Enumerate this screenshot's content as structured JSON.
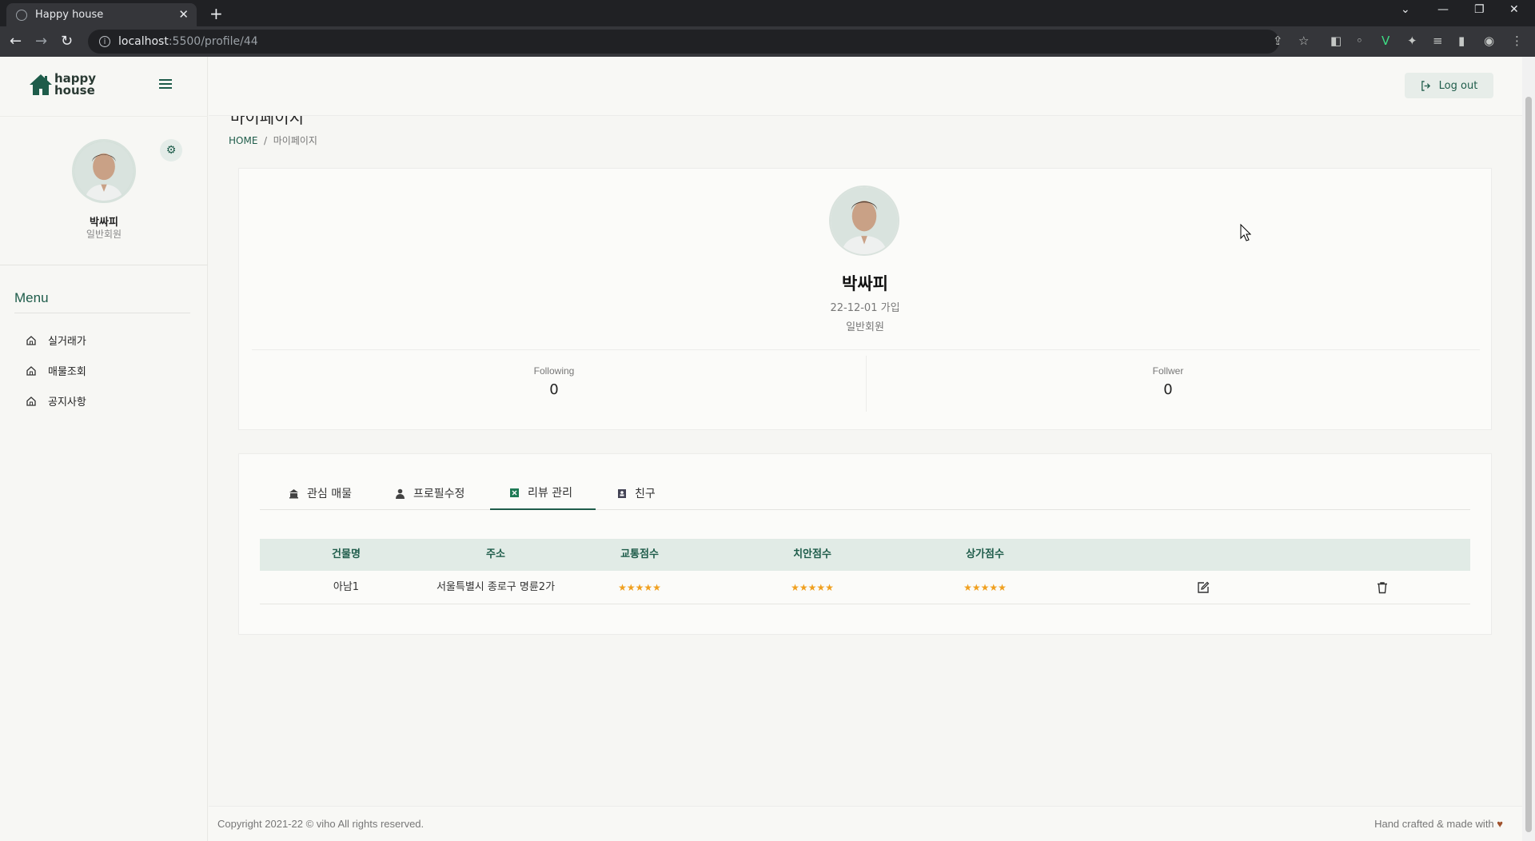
{
  "browser": {
    "tab_title": "Happy house",
    "url_host": "localhost",
    "url_path": ":5500/profile/44"
  },
  "app": {
    "logo_line1": "happy",
    "logo_line2": "house",
    "logout_label": "Log out"
  },
  "sidebar": {
    "user_name": "박싸피",
    "user_role": "일반회원",
    "menu_title": "Menu",
    "items": [
      {
        "label": "실거래가",
        "icon": "home-icon"
      },
      {
        "label": "매물조회",
        "icon": "home-icon"
      },
      {
        "label": "공지사항",
        "icon": "home-icon"
      }
    ]
  },
  "page": {
    "title": "마이페이지",
    "breadcrumb_home": "HOME",
    "breadcrumb_sep": "/",
    "breadcrumb_current": "마이페이지"
  },
  "profile": {
    "name": "박싸피",
    "joined": "22-12-01 가입",
    "role": "일반회원",
    "following_label": "Following",
    "following_count": "0",
    "follower_label": "Follwer",
    "follower_count": "0"
  },
  "tabs": [
    {
      "label": "관심 매물",
      "icon": "bank-icon"
    },
    {
      "label": "프로필수정",
      "icon": "user-icon"
    },
    {
      "label": "리뷰 관리",
      "icon": "spreadsheet-icon",
      "active": true
    },
    {
      "label": "친구",
      "icon": "contacts-icon"
    }
  ],
  "reviews": {
    "columns": [
      "건물명",
      "주소",
      "교통점수",
      "치안점수",
      "상가점수"
    ],
    "rows": [
      {
        "building": "아남1",
        "address": "서울특별시 종로구 명륜2가",
        "traffic": "★★★★★",
        "safety": "★★★★★",
        "commerce": "★★★★★",
        "traffic_score": 5,
        "safety_score": 5,
        "commerce_score": 5
      }
    ]
  },
  "footer": {
    "copyright": "Copyright 2021-22 © viho All rights reserved.",
    "crafted": "Hand crafted & made with",
    "heart": "♥"
  },
  "colors": {
    "accent": "#1e5c4a",
    "star": "#f0a020",
    "table_head": "#e1ebe6"
  }
}
